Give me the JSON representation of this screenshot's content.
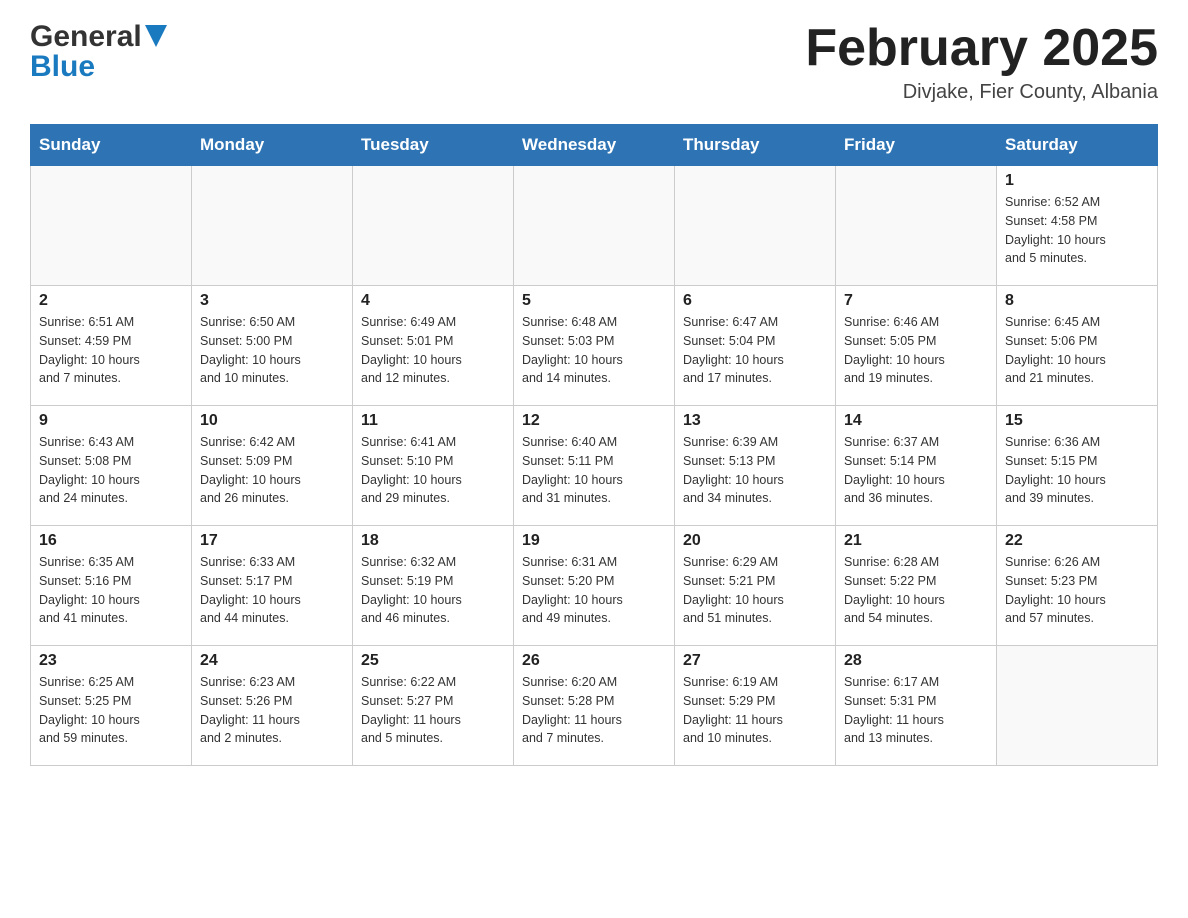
{
  "header": {
    "logo_general": "General",
    "logo_blue": "Blue",
    "title": "February 2025",
    "subtitle": "Divjake, Fier County, Albania"
  },
  "days_of_week": [
    "Sunday",
    "Monday",
    "Tuesday",
    "Wednesday",
    "Thursday",
    "Friday",
    "Saturday"
  ],
  "weeks": [
    [
      {
        "day": "",
        "info": ""
      },
      {
        "day": "",
        "info": ""
      },
      {
        "day": "",
        "info": ""
      },
      {
        "day": "",
        "info": ""
      },
      {
        "day": "",
        "info": ""
      },
      {
        "day": "",
        "info": ""
      },
      {
        "day": "1",
        "info": "Sunrise: 6:52 AM\nSunset: 4:58 PM\nDaylight: 10 hours\nand 5 minutes."
      }
    ],
    [
      {
        "day": "2",
        "info": "Sunrise: 6:51 AM\nSunset: 4:59 PM\nDaylight: 10 hours\nand 7 minutes."
      },
      {
        "day": "3",
        "info": "Sunrise: 6:50 AM\nSunset: 5:00 PM\nDaylight: 10 hours\nand 10 minutes."
      },
      {
        "day": "4",
        "info": "Sunrise: 6:49 AM\nSunset: 5:01 PM\nDaylight: 10 hours\nand 12 minutes."
      },
      {
        "day": "5",
        "info": "Sunrise: 6:48 AM\nSunset: 5:03 PM\nDaylight: 10 hours\nand 14 minutes."
      },
      {
        "day": "6",
        "info": "Sunrise: 6:47 AM\nSunset: 5:04 PM\nDaylight: 10 hours\nand 17 minutes."
      },
      {
        "day": "7",
        "info": "Sunrise: 6:46 AM\nSunset: 5:05 PM\nDaylight: 10 hours\nand 19 minutes."
      },
      {
        "day": "8",
        "info": "Sunrise: 6:45 AM\nSunset: 5:06 PM\nDaylight: 10 hours\nand 21 minutes."
      }
    ],
    [
      {
        "day": "9",
        "info": "Sunrise: 6:43 AM\nSunset: 5:08 PM\nDaylight: 10 hours\nand 24 minutes."
      },
      {
        "day": "10",
        "info": "Sunrise: 6:42 AM\nSunset: 5:09 PM\nDaylight: 10 hours\nand 26 minutes."
      },
      {
        "day": "11",
        "info": "Sunrise: 6:41 AM\nSunset: 5:10 PM\nDaylight: 10 hours\nand 29 minutes."
      },
      {
        "day": "12",
        "info": "Sunrise: 6:40 AM\nSunset: 5:11 PM\nDaylight: 10 hours\nand 31 minutes."
      },
      {
        "day": "13",
        "info": "Sunrise: 6:39 AM\nSunset: 5:13 PM\nDaylight: 10 hours\nand 34 minutes."
      },
      {
        "day": "14",
        "info": "Sunrise: 6:37 AM\nSunset: 5:14 PM\nDaylight: 10 hours\nand 36 minutes."
      },
      {
        "day": "15",
        "info": "Sunrise: 6:36 AM\nSunset: 5:15 PM\nDaylight: 10 hours\nand 39 minutes."
      }
    ],
    [
      {
        "day": "16",
        "info": "Sunrise: 6:35 AM\nSunset: 5:16 PM\nDaylight: 10 hours\nand 41 minutes."
      },
      {
        "day": "17",
        "info": "Sunrise: 6:33 AM\nSunset: 5:17 PM\nDaylight: 10 hours\nand 44 minutes."
      },
      {
        "day": "18",
        "info": "Sunrise: 6:32 AM\nSunset: 5:19 PM\nDaylight: 10 hours\nand 46 minutes."
      },
      {
        "day": "19",
        "info": "Sunrise: 6:31 AM\nSunset: 5:20 PM\nDaylight: 10 hours\nand 49 minutes."
      },
      {
        "day": "20",
        "info": "Sunrise: 6:29 AM\nSunset: 5:21 PM\nDaylight: 10 hours\nand 51 minutes."
      },
      {
        "day": "21",
        "info": "Sunrise: 6:28 AM\nSunset: 5:22 PM\nDaylight: 10 hours\nand 54 minutes."
      },
      {
        "day": "22",
        "info": "Sunrise: 6:26 AM\nSunset: 5:23 PM\nDaylight: 10 hours\nand 57 minutes."
      }
    ],
    [
      {
        "day": "23",
        "info": "Sunrise: 6:25 AM\nSunset: 5:25 PM\nDaylight: 10 hours\nand 59 minutes."
      },
      {
        "day": "24",
        "info": "Sunrise: 6:23 AM\nSunset: 5:26 PM\nDaylight: 11 hours\nand 2 minutes."
      },
      {
        "day": "25",
        "info": "Sunrise: 6:22 AM\nSunset: 5:27 PM\nDaylight: 11 hours\nand 5 minutes."
      },
      {
        "day": "26",
        "info": "Sunrise: 6:20 AM\nSunset: 5:28 PM\nDaylight: 11 hours\nand 7 minutes."
      },
      {
        "day": "27",
        "info": "Sunrise: 6:19 AM\nSunset: 5:29 PM\nDaylight: 11 hours\nand 10 minutes."
      },
      {
        "day": "28",
        "info": "Sunrise: 6:17 AM\nSunset: 5:31 PM\nDaylight: 11 hours\nand 13 minutes."
      },
      {
        "day": "",
        "info": ""
      }
    ]
  ]
}
